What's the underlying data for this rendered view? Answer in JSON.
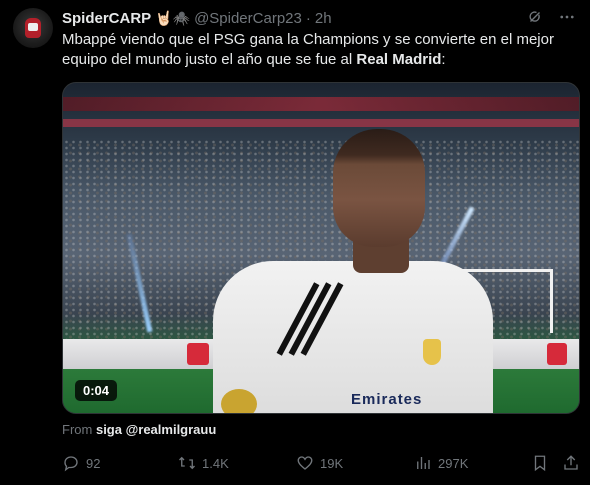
{
  "tweet": {
    "display_name": "SpiderCARP",
    "name_emojis": "🤘🏻🕷️",
    "handle": "@SpiderCarp23",
    "separator": "·",
    "time": "2h",
    "text_main": "Mbappé viendo que el PSG gana la Champions y se convierte en el mejor equipo del mundo justo el año que se fue al ",
    "text_bold": "Real Madrid",
    "text_end": ":"
  },
  "media": {
    "duration": "0:04",
    "sponsor_text": "Emirates"
  },
  "from": {
    "prefix": "From",
    "source": "siga @realmilgrauu"
  },
  "actions": {
    "replies": "92",
    "retweets": "1.4K",
    "likes": "19K",
    "views": "297K"
  },
  "icons": {
    "grok": "grok-icon",
    "more": "more-icon",
    "reply": "reply-icon",
    "retweet": "retweet-icon",
    "like": "heart-icon",
    "views": "views-icon",
    "bookmark": "bookmark-icon",
    "share": "share-icon"
  },
  "colors": {
    "background": "#000000",
    "text": "#e7e9ea",
    "muted": "#71767b"
  }
}
